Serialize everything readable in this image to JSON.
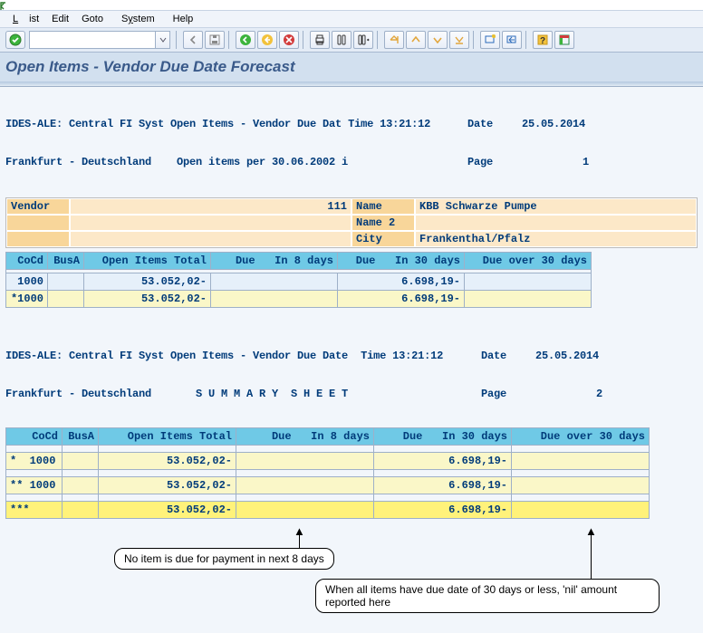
{
  "menu": {
    "list": "List",
    "edit": "Edit",
    "goto": "Goto",
    "system": "System",
    "help": "Help"
  },
  "title": "Open Items - Vendor Due Date Forecast",
  "hdr1": {
    "l1_left": "IDES-ALE: Central FI Syst Open Items - Vendor Due Dat Time 13:21:12",
    "l1_date_lbl": "Date",
    "l1_date": "25.05.2014",
    "l2_left": "Frankfurt - Deutschland    Open items per 30.06.2002 i",
    "l2_page_lbl": "Page",
    "l2_page": "1"
  },
  "vendor": {
    "vendor_lbl": "Vendor",
    "vendor_val": "111",
    "name_lbl": "Name",
    "name_val": "KBB Schwarze Pumpe",
    "name2_lbl": "Name 2",
    "name2_val": "",
    "city_lbl": "City",
    "city_val": "Frankenthal/Pfalz"
  },
  "cols": {
    "cocd": "CoCd",
    "busa": "BusA",
    "open": "Open Items Total",
    "d8": "Due   In 8 days",
    "d30": "Due   In 30 days",
    "dover": "Due over 30 days"
  },
  "detail_rows": [
    {
      "cocd": " 1000",
      "busa": "",
      "open": " 53.052,02-",
      "d8": "",
      "d30": "  6.698,19-",
      "dover": ""
    },
    {
      "cocd": "*1000",
      "busa": "",
      "open": " 53.052,02-",
      "d8": "",
      "d30": "  6.698,19-",
      "dover": ""
    }
  ],
  "hdr2": {
    "l1_left": "IDES-ALE: Central FI Syst Open Items - Vendor Due Date  Time 13:21:12",
    "l1_date_lbl": "Date",
    "l1_date": "25.05.2014",
    "l2_left": "Frankfurt - Deutschland       S U M M A R Y  S H E E T",
    "l2_page_lbl": "Page",
    "l2_page": "2"
  },
  "sum_rows": [
    {
      "cocd": "*  1000",
      "busa": "",
      "open": " 53.052,02-",
      "d8": "",
      "d30": "  6.698,19-",
      "dover": ""
    },
    {
      "cocd": "** 1000",
      "busa": "",
      "open": " 53.052,02-",
      "d8": "",
      "d30": "  6.698,19-",
      "dover": ""
    },
    {
      "cocd": "***    ",
      "busa": "",
      "open": " 53.052,02-",
      "d8": "",
      "d30": "  6.698,19-",
      "dover": ""
    }
  ],
  "ann1": "No item is due for payment in next 8 days",
  "ann2": "When all items have due date of 30 days or less, 'nil' amount reported here"
}
